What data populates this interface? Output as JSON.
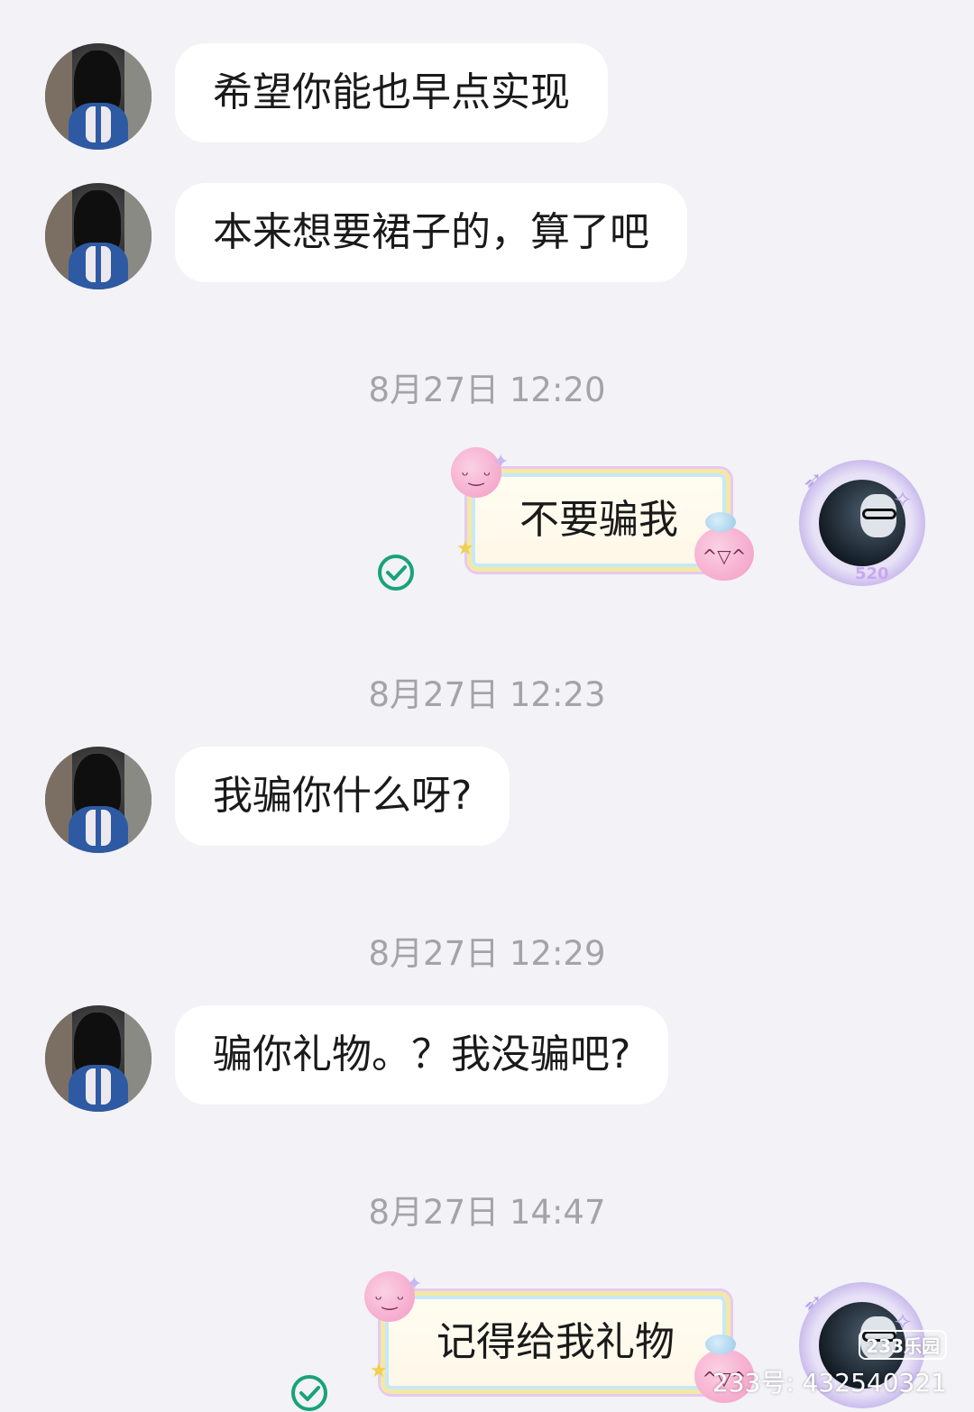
{
  "messages": [
    {
      "side": "left",
      "text": "希望你能也早点实现"
    },
    {
      "side": "left",
      "text": "本来想要裙子的，算了吧"
    },
    {
      "side": "left",
      "text": "我骗你什么呀?"
    },
    {
      "side": "left",
      "text": "骗你礼物。？我没骗吧?"
    }
  ],
  "my_messages": [
    {
      "text": "不要骗我",
      "status": "read"
    },
    {
      "text": "记得给我礼物",
      "status": "read"
    }
  ],
  "timestamps": [
    "8月27日 12:20",
    "8月27日 12:23",
    "8月27日 12:29",
    "8月27日 14:47"
  ],
  "my_avatar": {
    "badge": "520"
  },
  "watermark": {
    "logo": "233乐园",
    "id_text": "233号: 432540321"
  },
  "icons": {
    "read_check": "check-circle-icon"
  },
  "colors": {
    "background": "#f2f2f7",
    "bubble": "#ffffff",
    "check_green": "#19a27a",
    "timestamp": "#a3a3a8"
  }
}
